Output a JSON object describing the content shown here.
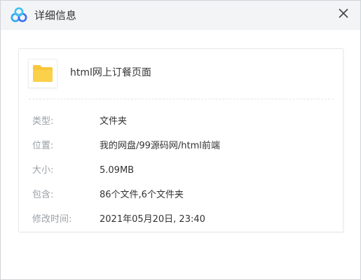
{
  "window": {
    "title": "详细信息",
    "icons": {
      "app": "baidu-netdisk-cloud-icon",
      "close": "close-icon",
      "file": "folder-icon"
    }
  },
  "file": {
    "name": "html网上订餐页面"
  },
  "details": [
    {
      "label": "类型:",
      "value": "文件夹"
    },
    {
      "label": "位置:",
      "value": "我的网盘/99源码网/html前端"
    },
    {
      "label": "大小:",
      "value": "5.09MB"
    },
    {
      "label": "包含:",
      "value": "86个文件,6个文件夹"
    },
    {
      "label": "修改时间:",
      "value": "2021年05月20日, 23:40"
    }
  ],
  "colors": {
    "titlebar_bg": "#f3f4f6",
    "label_text": "#9aa0a6",
    "value_text": "#333333",
    "folder": "#f9c73a",
    "brand_blue": "#3a7ff6"
  }
}
